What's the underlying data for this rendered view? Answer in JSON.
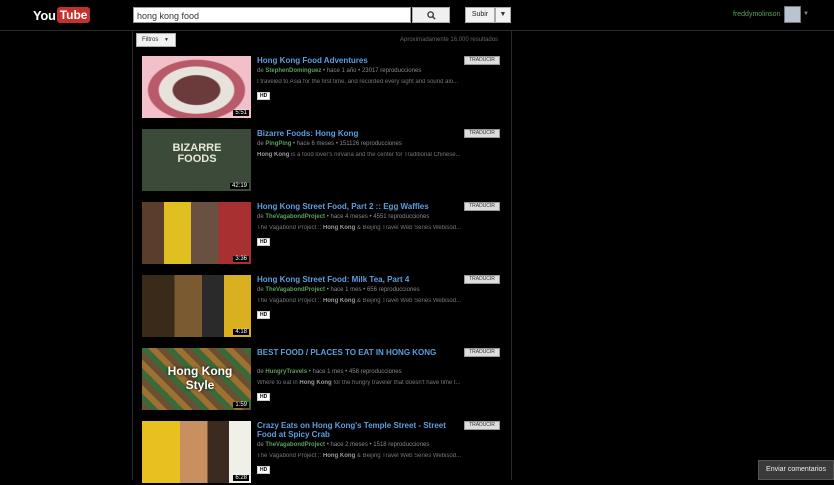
{
  "header": {
    "logo_you": "You",
    "logo_tube": "Tube",
    "search_value": "hong kong food",
    "upload_label": "Subir",
    "username": "freddymolinson"
  },
  "filters": {
    "label": "Filtros",
    "result_count": "Aproximadamente 16.000 resultados"
  },
  "translate_label": "TRADUCIR",
  "results": [
    {
      "title": "Hong Kong Food Adventures",
      "author_prefix": "de",
      "author": "StephenDominguez",
      "meta": "• hace 1 año • 23017 reproducciones",
      "desc_pre": "I traveled to Asia for the first time, and recorded every sight and sound alo...",
      "desc_bold": "",
      "desc_post": "",
      "duration": "5:51",
      "hd": "HD"
    },
    {
      "title": "Bizarre Foods: Hong Kong",
      "author_prefix": "de",
      "author": "PingPing",
      "meta": "• hace 6 meses • 151126 reproducciones",
      "desc_pre": "",
      "desc_bold": "Hong Kong",
      "desc_post": " is a food lover's nirvana and the center for Traditional Chinese...",
      "duration": "42:19",
      "hd": "",
      "thumb_text": "BIZARRE FOODS"
    },
    {
      "title": "Hong Kong Street Food, Part 2 :: Egg Waffles",
      "author_prefix": "de",
      "author": "TheVagabondProject",
      "meta": "• hace 4 meses • 4551 reproducciones",
      "desc_pre": "The Vagabond Project :: ",
      "desc_bold": "Hong Kong",
      "desc_post": " & Beijing Travel Web Series Webisod...",
      "duration": "3:36",
      "hd": "HD"
    },
    {
      "title": "Hong Kong Street Food: Milk Tea, Part 4",
      "author_prefix": "de",
      "author": "TheVagabondProject",
      "meta": "• hace 1 mes • 656 reproducciones",
      "desc_pre": "The Vagabond Project :: ",
      "desc_bold": "Hong Kong",
      "desc_post": " & Beijing Travel Web Series Webisod...",
      "duration": "4:18",
      "hd": "HD"
    },
    {
      "title": "BEST FOOD / PLACES TO EAT IN HONG KONG",
      "author_prefix": "de",
      "author": "HungryTravels",
      "meta": "• hace 1 mes • 458 reproducciones",
      "desc_pre": "Where to eat in ",
      "desc_bold": "Hong Kong",
      "desc_post": " for the hungry traveler that doesn't have time t...",
      "duration": "1:59",
      "hd": "HD",
      "thumb_text": "Hong Kong Style"
    },
    {
      "title": "Crazy Eats on Hong Kong's Temple Street - Street Food at Spicy Crab",
      "author_prefix": "de",
      "author": "TheVagabondProject",
      "meta": "• hace 2 meses • 1518 reproducciones",
      "desc_pre": "The Vagabond Project :: ",
      "desc_bold": "Hong Kong",
      "desc_post": " & Beijing Travel Web Series Webisod...",
      "duration": "6:28",
      "hd": "HD"
    }
  ],
  "feedback_label": "Enviar comentarios"
}
